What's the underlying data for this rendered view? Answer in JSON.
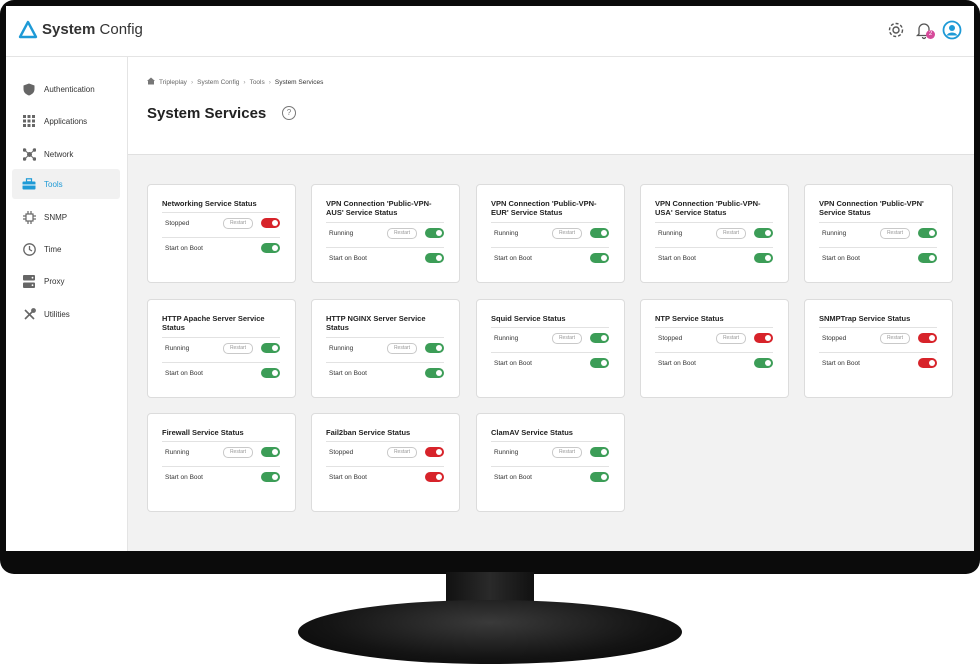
{
  "app": {
    "brand_bold": "System",
    "brand_light": " Config"
  },
  "topbar": {
    "notification_count": "2"
  },
  "sidebar": {
    "items": [
      {
        "label": "Authentication",
        "icon": "shield-icon",
        "active": false
      },
      {
        "label": "Applications",
        "icon": "grid-icon",
        "active": false
      },
      {
        "label": "Network",
        "icon": "network-icon",
        "active": false
      },
      {
        "label": "Tools",
        "icon": "toolbox-icon",
        "active": true
      },
      {
        "label": "SNMP",
        "icon": "snmp-icon",
        "active": false
      },
      {
        "label": "Time",
        "icon": "clock-icon",
        "active": false
      },
      {
        "label": "Proxy",
        "icon": "server-icon",
        "active": false
      },
      {
        "label": "Utilities",
        "icon": "wrench-icon",
        "active": false
      }
    ]
  },
  "breadcrumb": [
    "Tripleplay",
    "System Config",
    "Tools",
    "System Services"
  ],
  "page": {
    "title": "System Services",
    "help": "?"
  },
  "colors": {
    "accent": "#1e9ad6",
    "on": "#3c9d57",
    "off": "#d7232a"
  },
  "restart_label": "Restart",
  "boot_label": "Start on Boot",
  "services": [
    {
      "title": "Networking Service Status",
      "status": "Stopped",
      "status_on": false,
      "boot_on": true
    },
    {
      "title": "VPN Connection 'Public-VPN-AUS' Service Status",
      "status": "Running",
      "status_on": true,
      "boot_on": true
    },
    {
      "title": "VPN Connection 'Public-VPN-EUR' Service Status",
      "status": "Running",
      "status_on": true,
      "boot_on": true
    },
    {
      "title": "VPN Connection 'Public-VPN-USA' Service Status",
      "status": "Running",
      "status_on": true,
      "boot_on": true
    },
    {
      "title": "VPN Connection 'Public-VPN' Service Status",
      "status": "Running",
      "status_on": true,
      "boot_on": true
    },
    {
      "title": "HTTP Apache Server Service Status",
      "status": "Running",
      "status_on": true,
      "boot_on": true
    },
    {
      "title": "HTTP NGINX Server Service Status",
      "status": "Running",
      "status_on": true,
      "boot_on": true
    },
    {
      "title": "Squid Service Status",
      "status": "Running",
      "status_on": true,
      "boot_on": true
    },
    {
      "title": "NTP Service Status",
      "status": "Stopped",
      "status_on": false,
      "boot_on": true
    },
    {
      "title": "SNMPTrap Service Status",
      "status": "Stopped",
      "status_on": false,
      "boot_on": false
    },
    {
      "title": "Firewall Service Status",
      "status": "Running",
      "status_on": true,
      "boot_on": true
    },
    {
      "title": "Fail2ban Service Status",
      "status": "Stopped",
      "status_on": false,
      "boot_on": false
    },
    {
      "title": "ClamAV Service Status",
      "status": "Running",
      "status_on": true,
      "boot_on": true
    }
  ]
}
